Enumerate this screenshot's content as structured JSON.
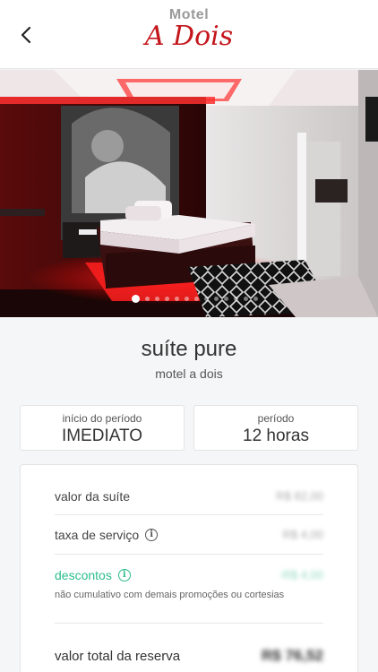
{
  "header": {
    "logo_top": "Motel",
    "logo_main": "A Dois",
    "back_icon": "chevron-left-icon"
  },
  "carousel": {
    "total_slides": 13,
    "active_index": 0
  },
  "suite": {
    "name": "suíte pure",
    "motel": "motel a dois"
  },
  "booking": {
    "start_label": "início do período",
    "start_value": "IMEDIATO",
    "period_label": "período",
    "period_value": "12 horas"
  },
  "pricing": {
    "suite_value_label": "valor da suíte",
    "suite_value": "R$ 82,00",
    "service_fee_label": "taxa de serviço",
    "service_fee_value": "R$ 4,00",
    "discounts_label": "descontos",
    "discounts_value": "-R$ 4,00",
    "discounts_note": "não cumulativo com demais promoções ou cortesias",
    "total_label": "valor total da reserva",
    "total_value": "R$ 76,52"
  },
  "colors": {
    "brand_red": "#c4161c",
    "discount_green": "#2bbd8c"
  }
}
